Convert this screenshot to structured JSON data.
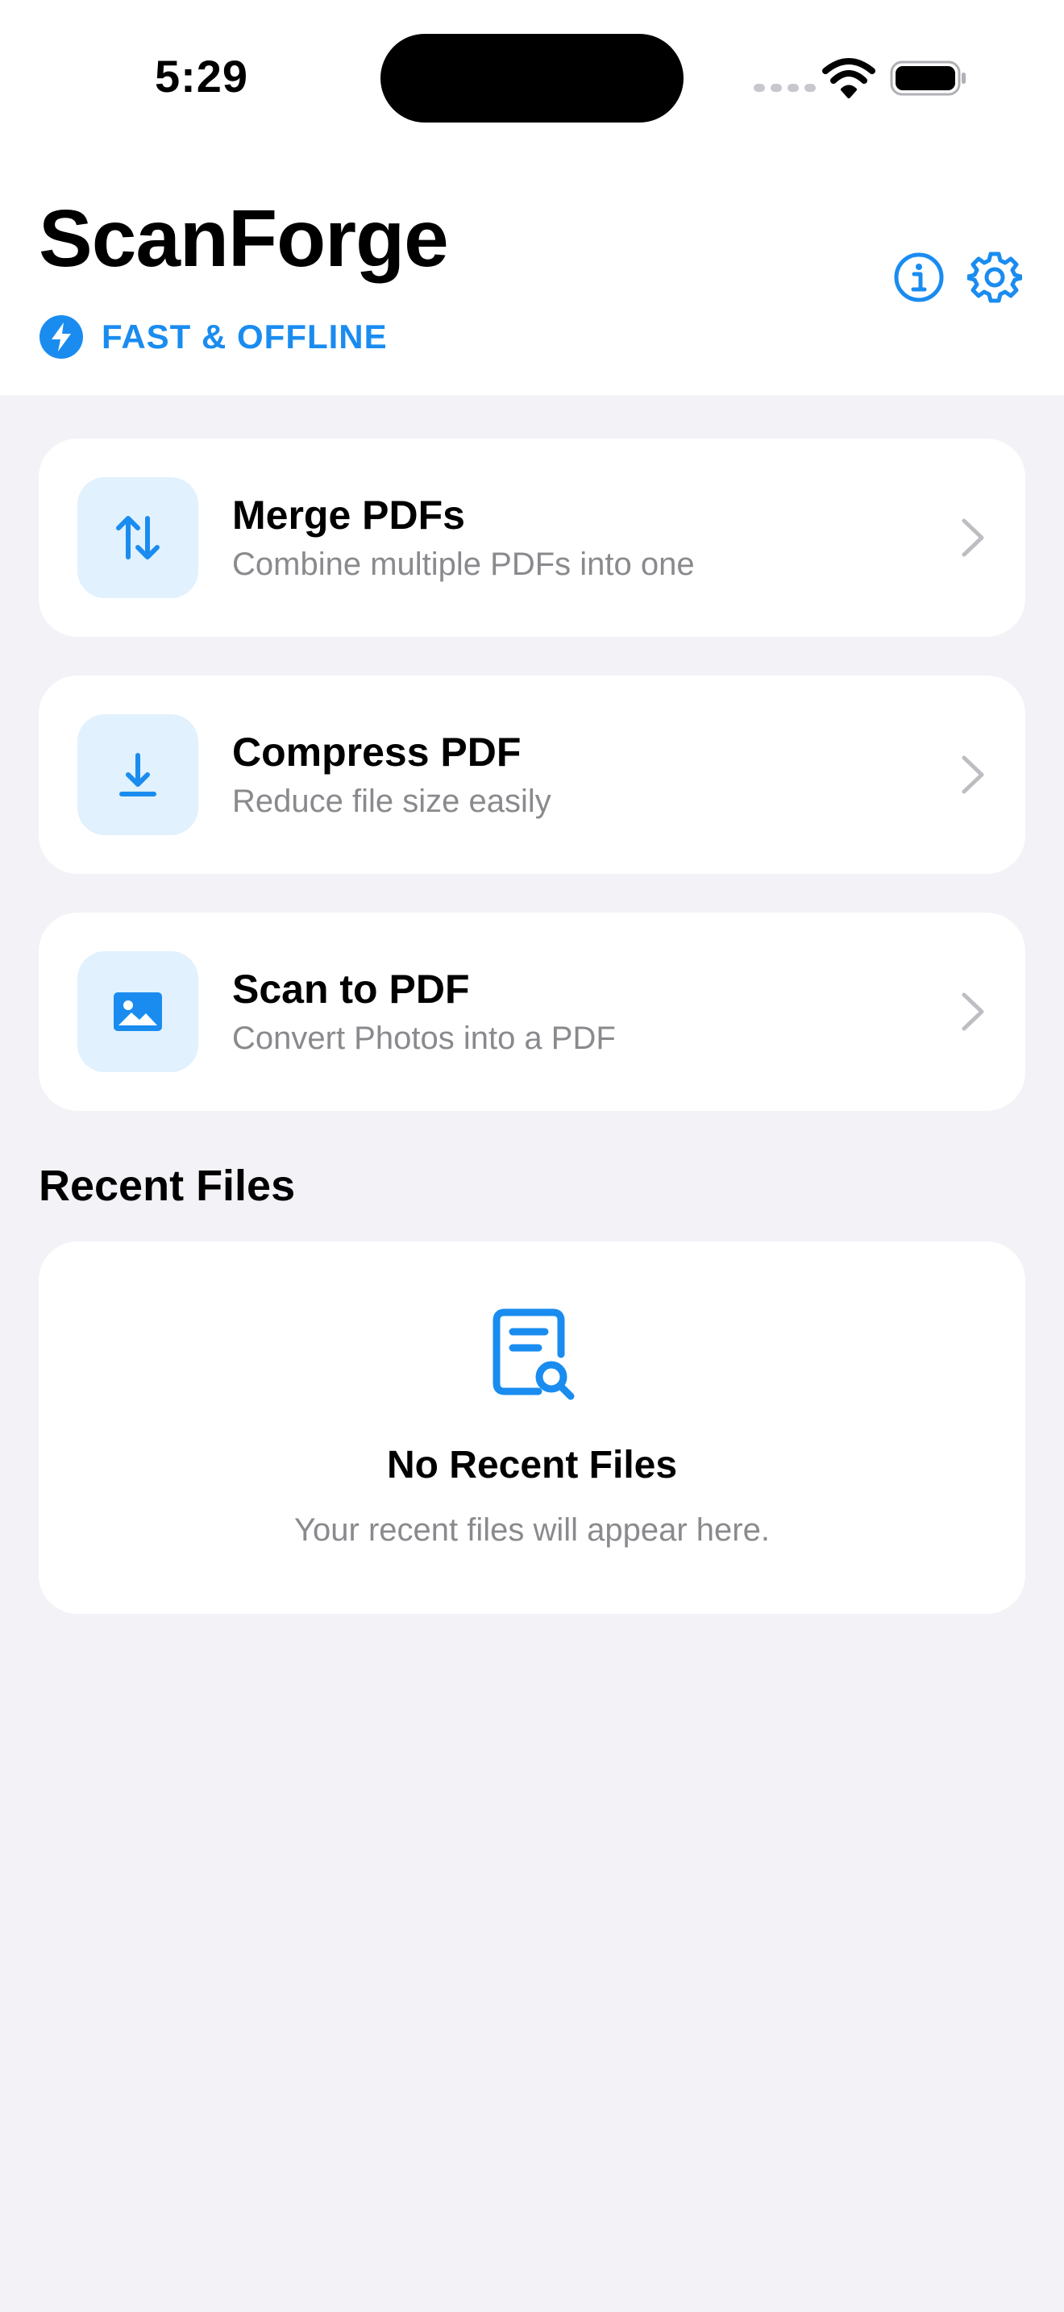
{
  "status_bar": {
    "time": "5:29",
    "icons": [
      "cellular-signal-icon",
      "wifi-icon",
      "battery-icon"
    ]
  },
  "header": {
    "title": "ScanForge",
    "tagline": "FAST & OFFLINE",
    "tagline_icon": "bolt-icon",
    "actions": [
      "info-icon",
      "gear-icon"
    ]
  },
  "tools": [
    {
      "title": "Merge PDFs",
      "description": "Combine multiple PDFs into one",
      "icon": "arrows-up-down-icon"
    },
    {
      "title": "Compress PDF",
      "description": "Reduce file size easily",
      "icon": "download-arrow-icon"
    },
    {
      "title": "Scan to PDF",
      "description": "Convert Photos into a PDF",
      "icon": "photo-icon"
    }
  ],
  "recent_files": {
    "section_title": "Recent Files",
    "empty_icon": "document-search-icon",
    "empty_title": "No Recent Files",
    "empty_message": "Your recent files will appear here."
  },
  "colors": {
    "accent": "#1A8CF0",
    "icon_background": "#E1F1FD",
    "page_background": "#F2F2F7",
    "card_background": "#FFFFFF",
    "secondary_text": "#8A8A8E"
  }
}
